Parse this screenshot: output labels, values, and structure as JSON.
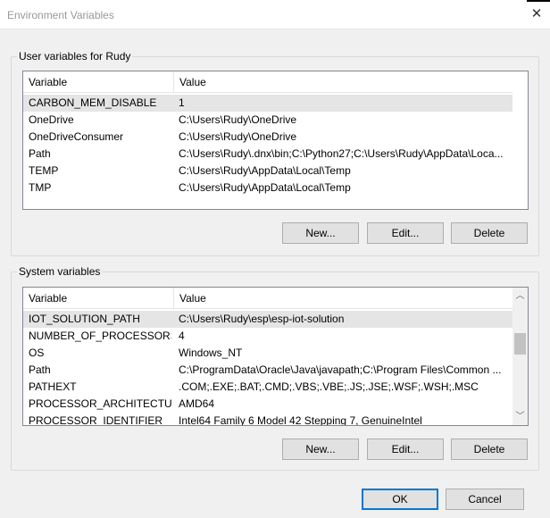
{
  "window": {
    "title": "Environment Variables",
    "close_glyph": "✕"
  },
  "user_section": {
    "label": "User variables for Rudy",
    "columns": [
      "Variable",
      "Value"
    ],
    "rows": [
      {
        "name": "CARBON_MEM_DISABLE",
        "value": "1",
        "selected": true
      },
      {
        "name": "OneDrive",
        "value": "C:\\Users\\Rudy\\OneDrive"
      },
      {
        "name": "OneDriveConsumer",
        "value": "C:\\Users\\Rudy\\OneDrive"
      },
      {
        "name": "Path",
        "value": "C:\\Users\\Rudy\\.dnx\\bin;C:\\Python27;C:\\Users\\Rudy\\AppData\\Loca..."
      },
      {
        "name": "TEMP",
        "value": "C:\\Users\\Rudy\\AppData\\Local\\Temp"
      },
      {
        "name": "TMP",
        "value": "C:\\Users\\Rudy\\AppData\\Local\\Temp"
      }
    ],
    "buttons": {
      "new": "New...",
      "edit": "Edit...",
      "delete": "Delete"
    }
  },
  "system_section": {
    "label": "System variables",
    "columns": [
      "Variable",
      "Value"
    ],
    "rows": [
      {
        "name": "IOT_SOLUTION_PATH",
        "value": "C:\\Users\\Rudy\\esp\\esp-iot-solution",
        "selected": true
      },
      {
        "name": "NUMBER_OF_PROCESSORS",
        "value": "4"
      },
      {
        "name": "OS",
        "value": "Windows_NT"
      },
      {
        "name": "Path",
        "value": "C:\\ProgramData\\Oracle\\Java\\javapath;C:\\Program Files\\Common ..."
      },
      {
        "name": "PATHEXT",
        "value": ".COM;.EXE;.BAT;.CMD;.VBS;.VBE;.JS;.JSE;.WSF;.WSH;.MSC"
      },
      {
        "name": "PROCESSOR_ARCHITECTURE",
        "value": "AMD64"
      },
      {
        "name": "PROCESSOR_IDENTIFIER",
        "value": "Intel64 Family 6 Model 42 Stepping 7, GenuineIntel"
      }
    ],
    "buttons": {
      "new": "New...",
      "edit": "Edit...",
      "delete": "Delete"
    },
    "scrollbar": {
      "up_glyph": "︿",
      "down_glyph": "﹀"
    }
  },
  "footer": {
    "ok": "OK",
    "cancel": "Cancel"
  },
  "colors": {
    "selected_row": "#e5e5e5",
    "default_button_border": "#0078d7",
    "listview_border": "#828790"
  }
}
